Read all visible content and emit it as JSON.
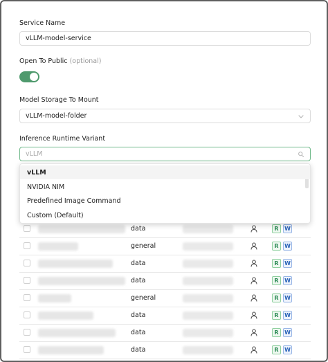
{
  "form": {
    "service_name": {
      "label": "Service Name",
      "value": "vLLM-model-service"
    },
    "open_to_public": {
      "label": "Open To Public",
      "optional": "(optional)",
      "enabled": true
    },
    "model_storage": {
      "label": "Model Storage To Mount",
      "value": "vLLM-model-folder"
    },
    "runtime_variant": {
      "label": "Inference Runtime Variant",
      "placeholder": "vLLM"
    }
  },
  "dropdown": {
    "options": [
      "vLLM",
      "NVIDIA NIM",
      "Predefined Image Command",
      "Custom (Default)"
    ],
    "selected": "vLLM"
  },
  "table": {
    "rows": [
      {
        "type": "data",
        "perm_read": "R",
        "perm_write": "W"
      },
      {
        "type": "general",
        "perm_read": "R",
        "perm_write": "W"
      },
      {
        "type": "data",
        "perm_read": "R",
        "perm_write": "W"
      },
      {
        "type": "data",
        "perm_read": "R",
        "perm_write": "W"
      },
      {
        "type": "general",
        "perm_read": "R",
        "perm_write": "W"
      },
      {
        "type": "data",
        "perm_read": "R",
        "perm_write": "W"
      },
      {
        "type": "data",
        "perm_read": "R",
        "perm_write": "W"
      },
      {
        "type": "data",
        "perm_read": "R",
        "perm_write": "W"
      }
    ]
  },
  "colors": {
    "accent": "#4f9a6d",
    "focus_border": "#6fb98a",
    "read_badge": "#2e8b57",
    "write_badge": "#2a63b8"
  },
  "icons": {
    "storage_select": "chevron-down-icon",
    "runtime_select": "search-icon",
    "owner": "user-icon"
  }
}
